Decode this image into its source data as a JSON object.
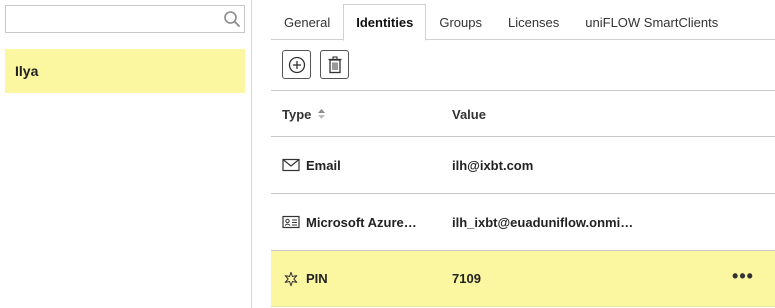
{
  "search": {
    "placeholder": "",
    "value": ""
  },
  "users": [
    {
      "name": "Ilya",
      "selected": true
    }
  ],
  "tabs": [
    {
      "label": "General",
      "active": false
    },
    {
      "label": "Identities",
      "active": true
    },
    {
      "label": "Groups",
      "active": false
    },
    {
      "label": "Licenses",
      "active": false
    },
    {
      "label": "uniFLOW SmartClients",
      "active": false
    }
  ],
  "toolbar": {
    "add_icon": "add-circle-icon",
    "delete_icon": "trash-icon"
  },
  "table": {
    "headers": {
      "type": "Type",
      "value": "Value"
    },
    "rows": [
      {
        "type": "Email",
        "icon": "envelope-icon",
        "value": "ilh@ixbt.com",
        "selected": false
      },
      {
        "type": "Microsoft Azure…",
        "icon": "id-card-icon",
        "value": "ilh_ixbt@euaduniflow.onmi…",
        "selected": false
      },
      {
        "type": "PIN",
        "icon": "pin-asterisk-icon",
        "value": "7109",
        "selected": true,
        "actions": "•••"
      }
    ]
  },
  "colors": {
    "highlight": "#fbf6a0",
    "border": "#c8c8c8"
  }
}
